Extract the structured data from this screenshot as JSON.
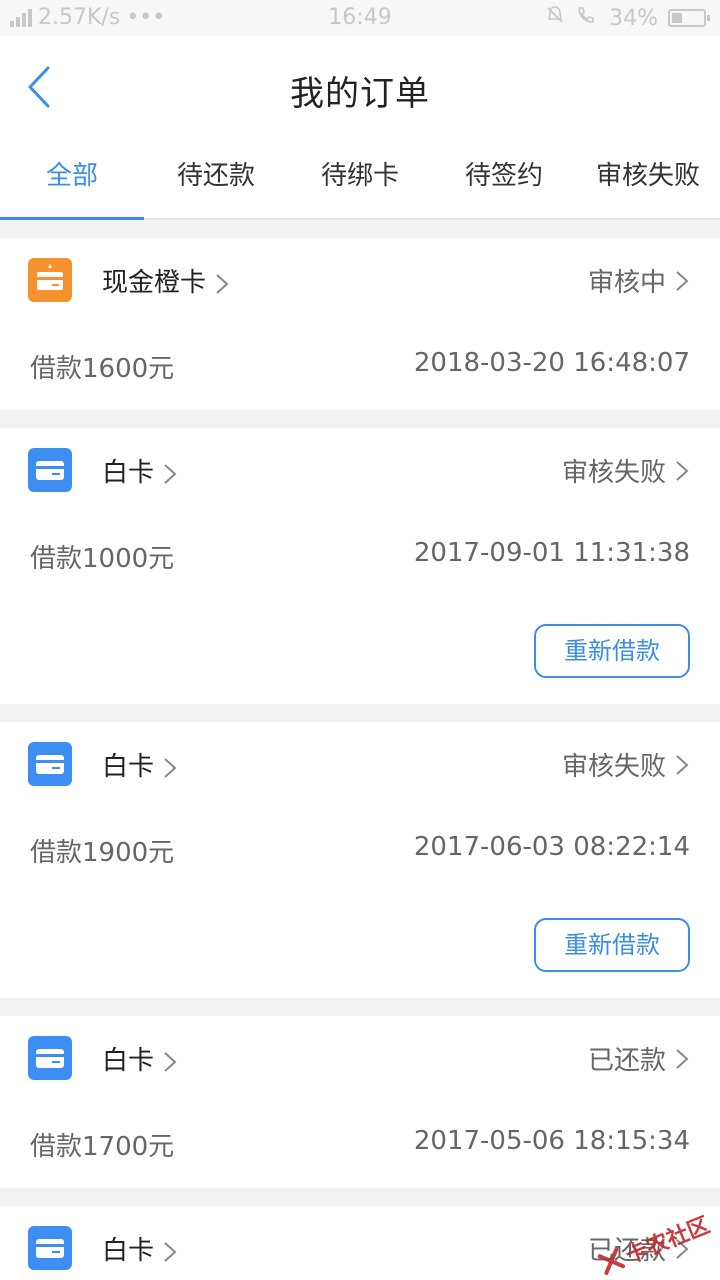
{
  "status_bar": {
    "network": "2.57K/s",
    "dots": "•••",
    "time": "16:49",
    "battery": "34%",
    "battery_level": 0.34
  },
  "header": {
    "title": "我的订单",
    "back_icon": "chevron-left-icon"
  },
  "tabs": [
    {
      "label": "全部",
      "active": true
    },
    {
      "label": "待还款",
      "active": false
    },
    {
      "label": "待绑卡",
      "active": false
    },
    {
      "label": "待签约",
      "active": false
    },
    {
      "label": "审核失败",
      "active": false
    }
  ],
  "orders": [
    {
      "product": "现金橙卡",
      "icon": "orange-card-icon",
      "status": "审核中",
      "amount": "借款1600元",
      "time": "2018-03-20 16:48:07"
    },
    {
      "product": "白卡",
      "icon": "blue-card-icon",
      "status": "审核失败",
      "amount": "借款1000元",
      "time": "2017-09-01 11:31:38",
      "action": "重新借款"
    },
    {
      "product": "白卡",
      "icon": "blue-card-icon",
      "status": "审核失败",
      "amount": "借款1900元",
      "time": "2017-06-03 08:22:14",
      "action": "重新借款"
    },
    {
      "product": "白卡",
      "icon": "blue-card-icon",
      "status": "已还款",
      "amount": "借款1700元",
      "time": "2017-05-06 18:15:34"
    },
    {
      "product": "白卡",
      "icon": "blue-card-icon",
      "status": "已还款"
    }
  ],
  "watermark": "卡农社区",
  "colors": {
    "accent": "#3a8ee6",
    "orange": "#f5922f",
    "blue": "#3c8ef3"
  }
}
